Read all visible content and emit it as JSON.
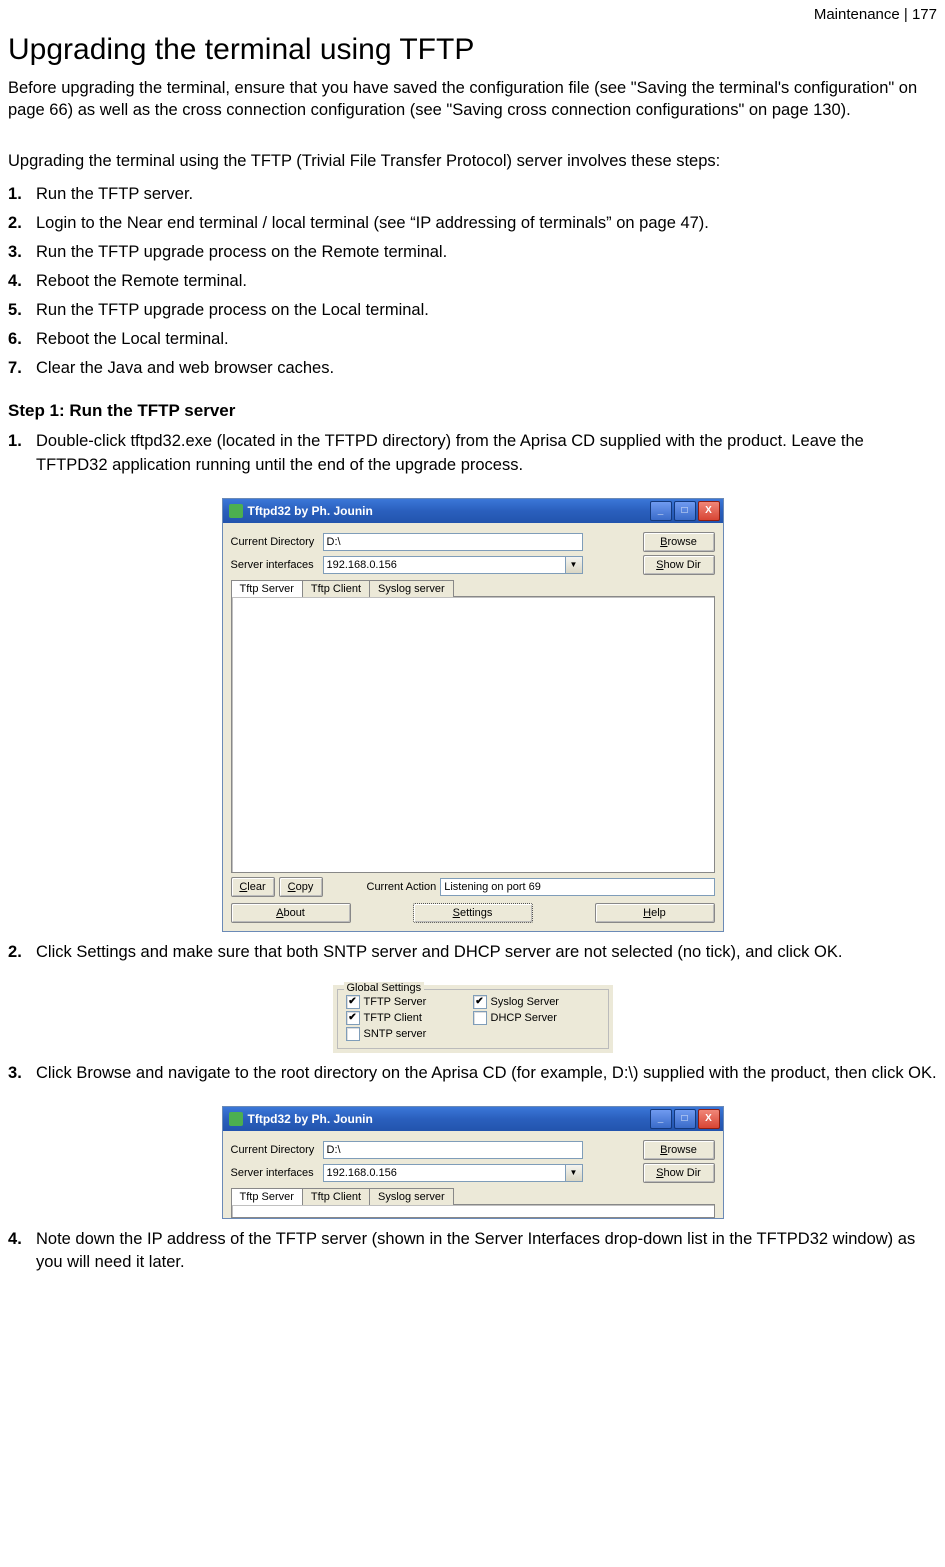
{
  "page_header": "Maintenance  |  177",
  "title": "Upgrading the terminal using TFTP",
  "intro_para": "Before upgrading the terminal, ensure that you have saved the configuration file (see \"Saving the terminal's configuration\" on page 66) as well as the cross connection configuration (see \"Saving cross connection configurations\" on page 130).",
  "steps_intro": "Upgrading the terminal using the TFTP (Trivial File Transfer Protocol) server involves these steps:",
  "overview_steps": [
    "Run the TFTP server.",
    "Login to the Near end terminal / local terminal (see “IP addressing of terminals” on page 47).",
    "Run the TFTP upgrade process on the Remote terminal.",
    "Reboot the Remote terminal.",
    "Run the TFTP upgrade process on the Local terminal.",
    "Reboot the Local terminal.",
    "Clear the Java and web browser caches."
  ],
  "step1_heading": "Step 1: Run the TFTP server",
  "step1_items": {
    "i1": "Double-click tftpd32.exe (located in the TFTPD directory) from the Aprisa CD supplied with the product. Leave the TFTPD32 application running until the end of the upgrade process.",
    "i2": "Click Settings and make sure that both SNTP server and DHCP server are not selected (no tick), and click OK.",
    "i3": "Click Browse and navigate to the root directory on the Aprisa CD (for example, D:\\) supplied with the product, then click OK.",
    "i4": "Note down the IP address of the TFTP server (shown in the Server Interfaces drop-down list in the TFTPD32 window) as you will need it later."
  },
  "window": {
    "title": "Tftpd32 by Ph. Jounin",
    "labels": {
      "curdir": "Current Directory",
      "srvint": "Server interfaces",
      "current_action_lbl": "Current Action"
    },
    "values": {
      "curdir": "D:\\",
      "srvint": "192.168.0.156",
      "status": "Listening on port 69"
    },
    "buttons": {
      "browse": "Browse",
      "showdir": "Show Dir",
      "clear": "Clear",
      "copy": "Copy",
      "about": "About",
      "settings": "Settings",
      "help": "Help"
    },
    "tabs": {
      "t1": "Tftp Server",
      "t2": "Tftp Client",
      "t3": "Syslog server"
    }
  },
  "settings_box": {
    "legend": "Global Settings",
    "tftp_server": "TFTP Server",
    "tftp_client": "TFTP Client",
    "sntp_server": "SNTP server",
    "syslog_server": "Syslog Server",
    "dhcp_server": "DHCP Server"
  }
}
